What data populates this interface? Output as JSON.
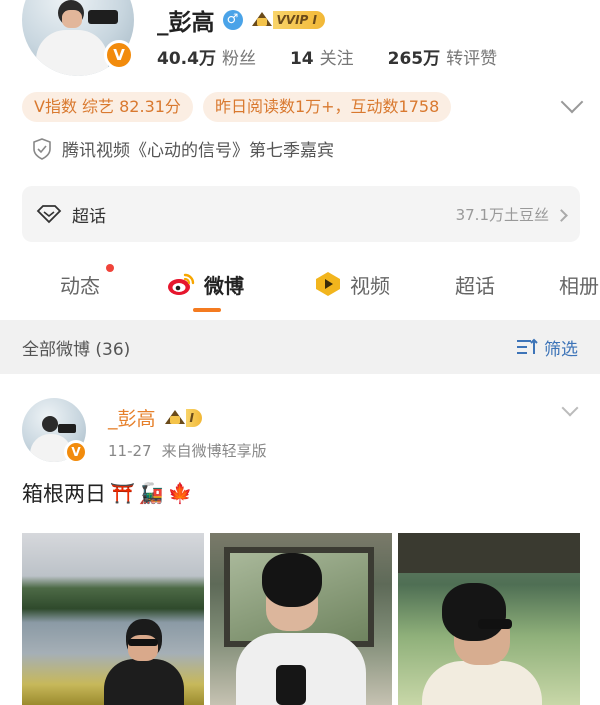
{
  "profile": {
    "name": "_彭高",
    "gender_icon": "male-icon",
    "vip_label": "VVIP I",
    "stats": [
      {
        "value": "40.4万",
        "label": "粉丝"
      },
      {
        "value": "14",
        "label": "关注"
      },
      {
        "value": "265万",
        "label": "转评赞"
      }
    ],
    "tags": [
      "V指数 综艺 82.31分",
      "昨日阅读数1万+，互动数1758"
    ],
    "certification": "腾讯视频《心动的信号》第七季嘉宾"
  },
  "chaohua": {
    "label": "超话",
    "fans": "37.1万土豆丝"
  },
  "tabs": [
    {
      "label": "动态"
    },
    {
      "label": "微博"
    },
    {
      "label": "视频"
    },
    {
      "label": "超话"
    },
    {
      "label": "相册"
    }
  ],
  "filter_bar": {
    "all_label": "全部微博 (36)",
    "filter_label": "筛选"
  },
  "post": {
    "author": "_彭高",
    "vip_label": "I",
    "date": "11-27",
    "source": "来自微博轻享版",
    "text": "箱根两日",
    "emojis": [
      "⛩️",
      "🚂",
      "🍁"
    ]
  },
  "colors": {
    "accent_orange": "#f47b20",
    "tag_text": "#d9792f",
    "tag_bg": "#fbeee3",
    "link_blue": "#3d74b8",
    "verified_badge": "#f28b0c"
  }
}
